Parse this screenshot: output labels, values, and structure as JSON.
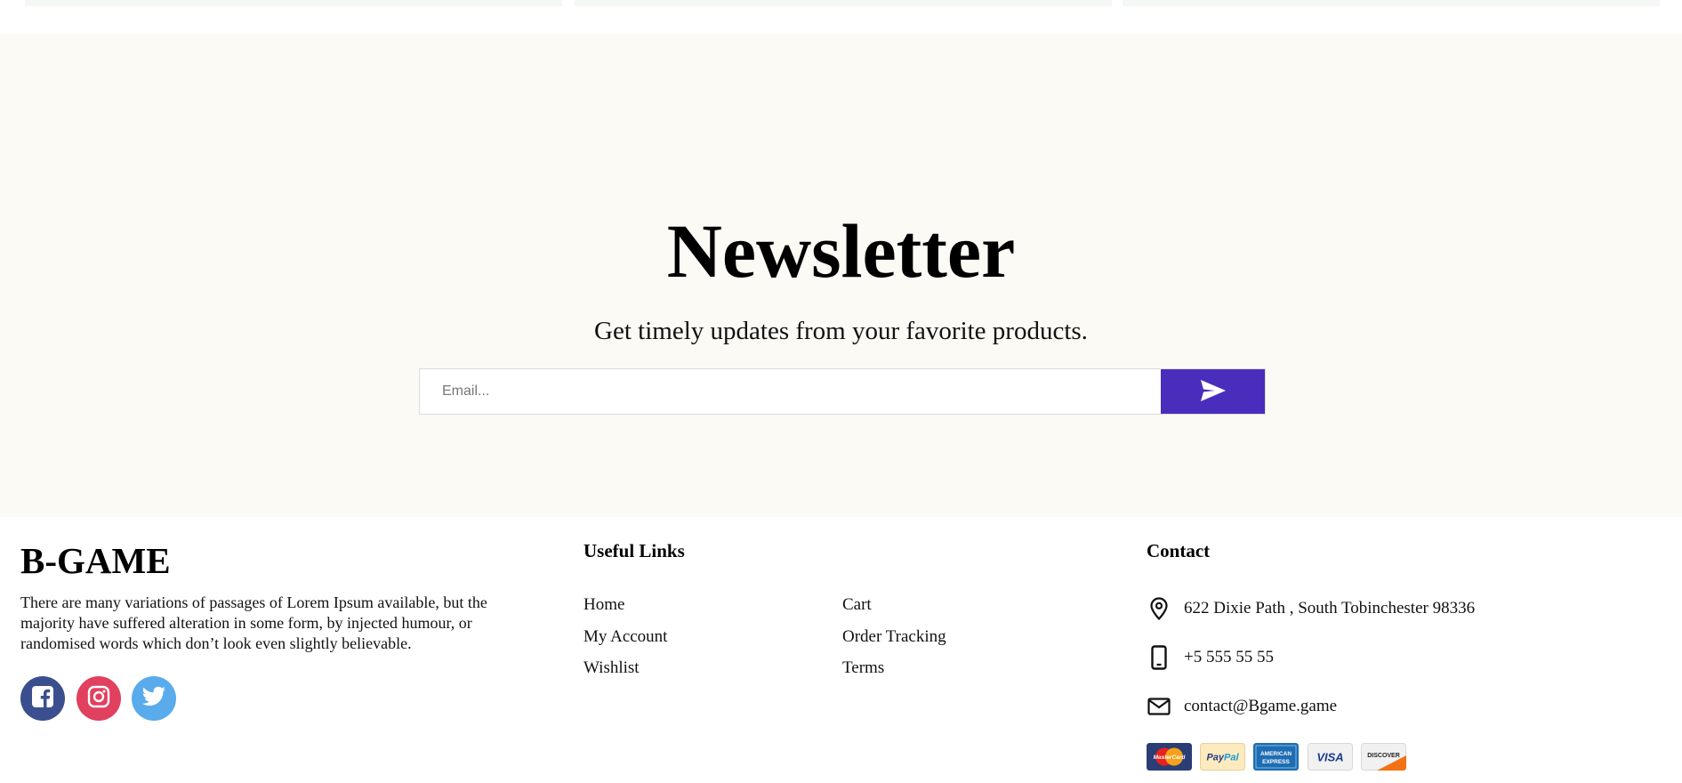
{
  "newsletter": {
    "title": "Newsletter",
    "subtitle": "Get timely updates from your favorite products.",
    "email_placeholder": "Email...",
    "submit_icon": "send-icon",
    "accent_color": "#4b2dbd",
    "background_color": "#fbfaf4"
  },
  "footer": {
    "brand": "B-GAME",
    "about": "There are many variations of passages of Lorem Ipsum available, but the majority have suffered alteration in some form, by injected humour, or randomised words which don’t look even slightly believable.",
    "social": [
      {
        "name": "facebook",
        "icon": "facebook-icon",
        "color": "#3b4f8f"
      },
      {
        "name": "instagram",
        "icon": "instagram-icon",
        "color": "#e1405f"
      },
      {
        "name": "twitter",
        "icon": "twitter-icon",
        "color": "#5aabec"
      }
    ],
    "useful_links": {
      "title": "Useful Links",
      "col1": [
        "Home",
        "My Account",
        "Wishlist"
      ],
      "col2": [
        "Cart",
        "Order Tracking",
        "Terms"
      ]
    },
    "contact": {
      "title": "Contact",
      "address": "622 Dixie Path , South Tobinchester 98336",
      "phone": "+5 555 55 55",
      "email": "contact@Bgame.game",
      "address_icon": "location-pin-icon",
      "phone_icon": "mobile-phone-icon",
      "email_icon": "envelope-icon"
    },
    "payment_methods": [
      {
        "name": "MasterCard",
        "icon": "mastercard-icon"
      },
      {
        "name": "PayPal",
        "icon": "paypal-icon"
      },
      {
        "name": "AMERICAN EXPRESS",
        "icon": "amex-icon"
      },
      {
        "name": "VISA",
        "icon": "visa-icon"
      },
      {
        "name": "DISCOVER",
        "icon": "discover-icon"
      }
    ]
  }
}
